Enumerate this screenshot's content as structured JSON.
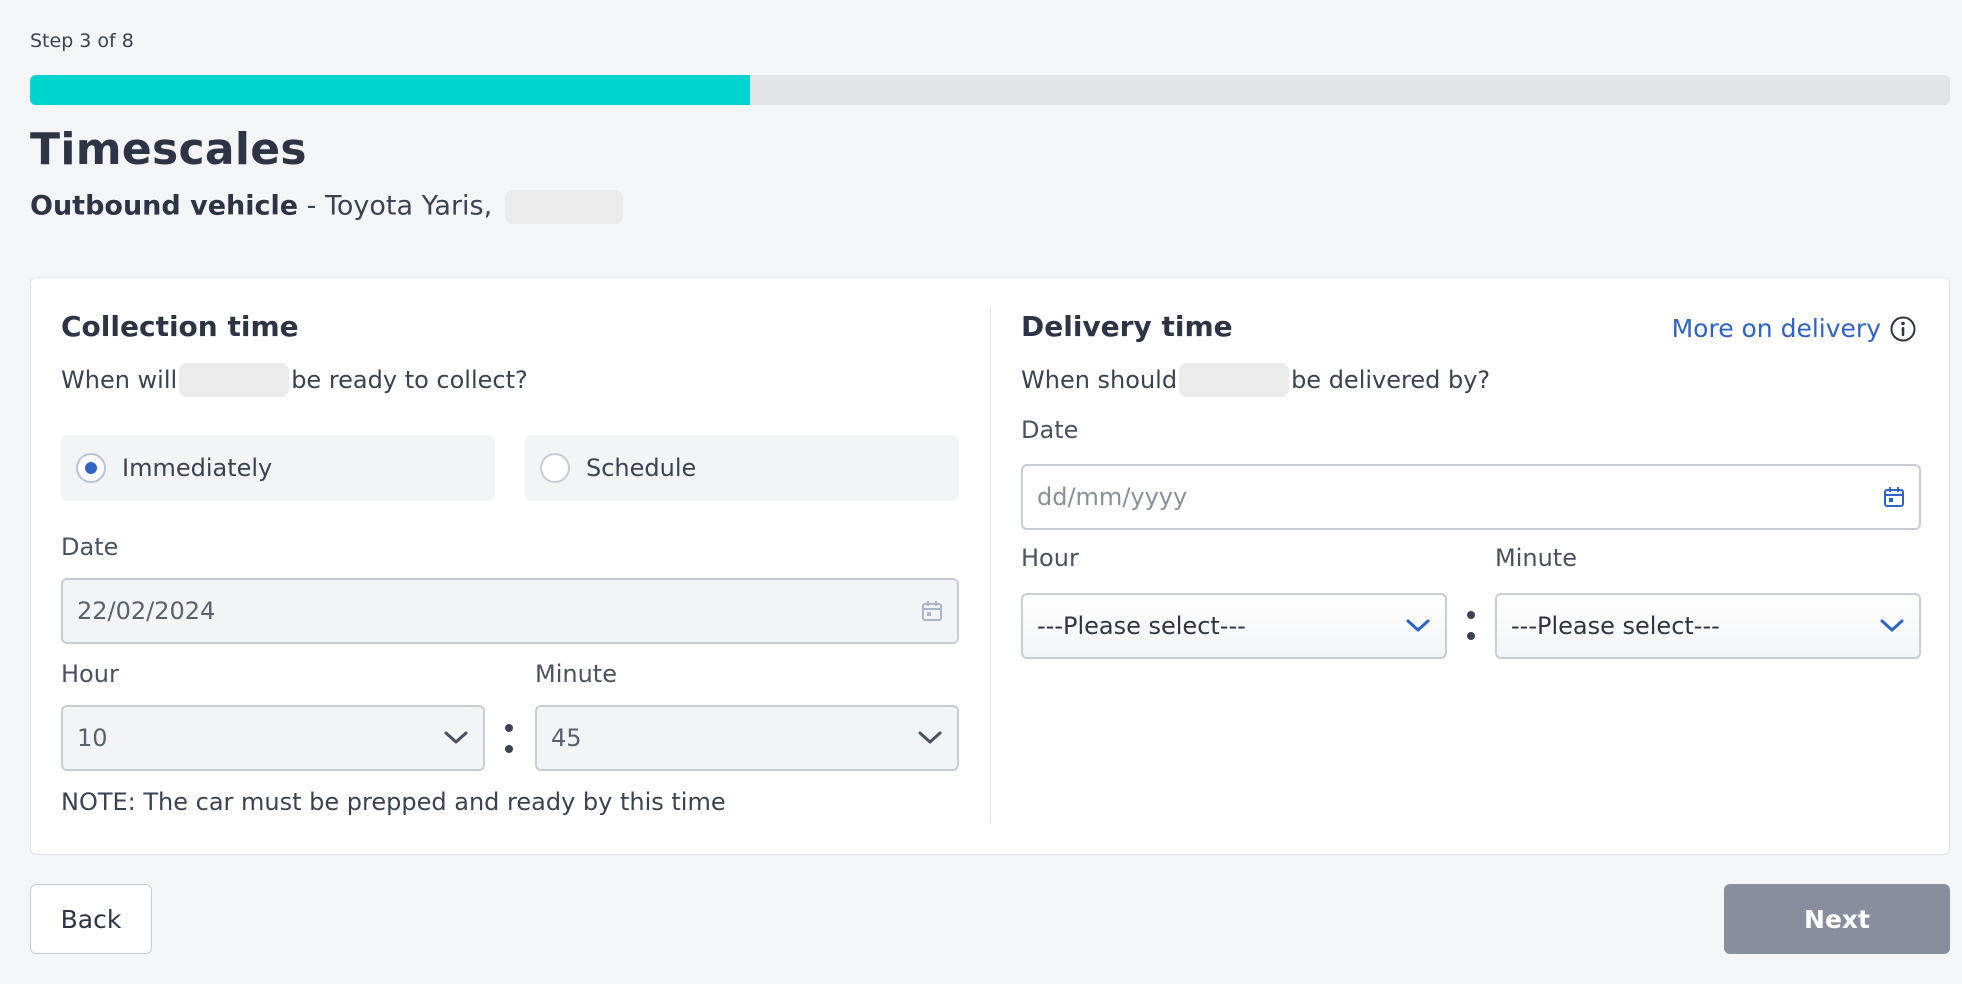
{
  "progress": {
    "label": "Step 3 of 8",
    "fraction": 0.375,
    "color": "#00d4ce"
  },
  "header": {
    "title": "Timescales",
    "subtitle_strong": "Outbound vehicle",
    "subtitle_rest": " - Toyota Yaris,"
  },
  "collection": {
    "title": "Collection time",
    "question_before": "When will",
    "question_after": "be ready to collect?",
    "options": [
      {
        "label": "Immediately",
        "selected": true
      },
      {
        "label": "Schedule",
        "selected": false
      }
    ],
    "date_label": "Date",
    "date_value": "22/02/2024",
    "hour_label": "Hour",
    "hour_value": "10",
    "minute_label": "Minute",
    "minute_value": "45",
    "note": "NOTE: The car must be prepped and ready by this time"
  },
  "delivery": {
    "title": "Delivery time",
    "more_link": "More on delivery",
    "question_before": "When should",
    "question_after": "be delivered by?",
    "date_label": "Date",
    "date_placeholder": "dd/mm/yyyy",
    "hour_label": "Hour",
    "hour_value": "---Please select---",
    "minute_label": "Minute",
    "minute_value": "---Please select---"
  },
  "buttons": {
    "back": "Back",
    "next": "Next"
  },
  "colors": {
    "accent": "#2f62c6",
    "next_disabled": "#888e9d"
  },
  "icons": [
    "calendar-icon",
    "chevron-down-icon",
    "info-icon"
  ]
}
